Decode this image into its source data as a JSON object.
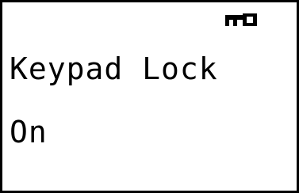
{
  "status": {
    "icon": "key-icon"
  },
  "screen": {
    "title": "Keypad Lock",
    "value": "On"
  },
  "colors": {
    "foreground": "#000000",
    "background": "#ffffff"
  }
}
